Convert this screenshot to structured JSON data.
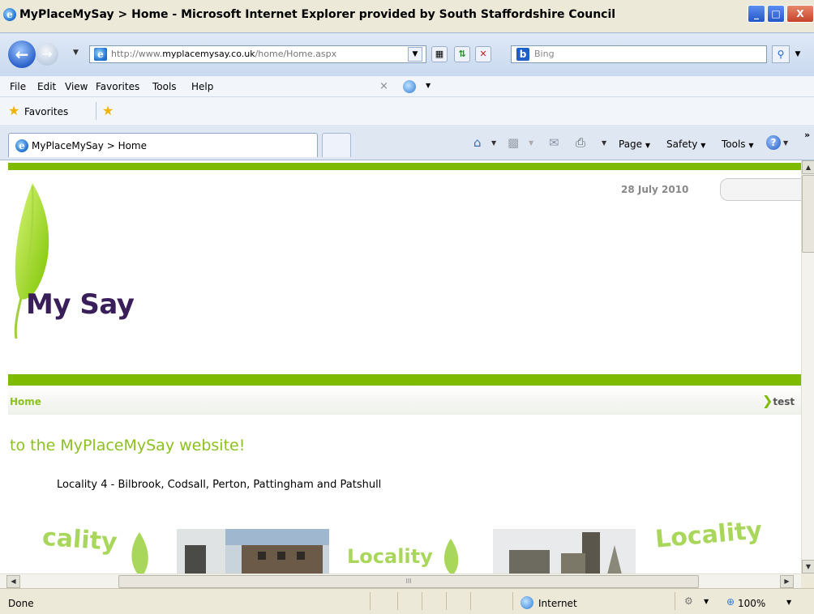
{
  "window": {
    "title": "MyPlaceMySay > Home - Microsoft Internet Explorer provided by South Staffordshire Council",
    "min_glyph": "_",
    "max_glyph": "□",
    "close_glyph": "X"
  },
  "address": {
    "url_prefix": "http://www.",
    "url_domain": "myplacemysay.co.uk",
    "url_path": "/home/Home.aspx",
    "search_placeholder": "Bing",
    "search_brand_glyph": "b"
  },
  "menu": {
    "items": [
      "File",
      "Edit",
      "View",
      "Favorites",
      "Tools",
      "Help"
    ],
    "x_glyph": "×"
  },
  "favorites_bar": {
    "label": "Favorites"
  },
  "tabs": {
    "active_label": "MyPlaceMySay > Home"
  },
  "command_bar": {
    "page": "Page",
    "safety": "Safety",
    "tools": "Tools",
    "help_glyph": "?",
    "more_glyph": "»"
  },
  "page": {
    "date": "28 July 2010",
    "site_name": "My Say",
    "breadcrumb_home": "Home",
    "user_link": "test",
    "welcome": "to the MyPlaceMySay website!",
    "locality_text": "Locality 4 - Bilbrook, Codsall, Perton, Pattingham and Patshull",
    "banner_words": [
      "cality",
      "Locality",
      "Locality"
    ],
    "hscroll_grip": "III"
  },
  "status": {
    "text": "Done",
    "zone": "Internet",
    "zoom": "100%"
  },
  "colors": {
    "brand_green": "#7dba00",
    "brand_light_green": "#8cc21f",
    "site_name_purple": "#3a1e5a"
  }
}
